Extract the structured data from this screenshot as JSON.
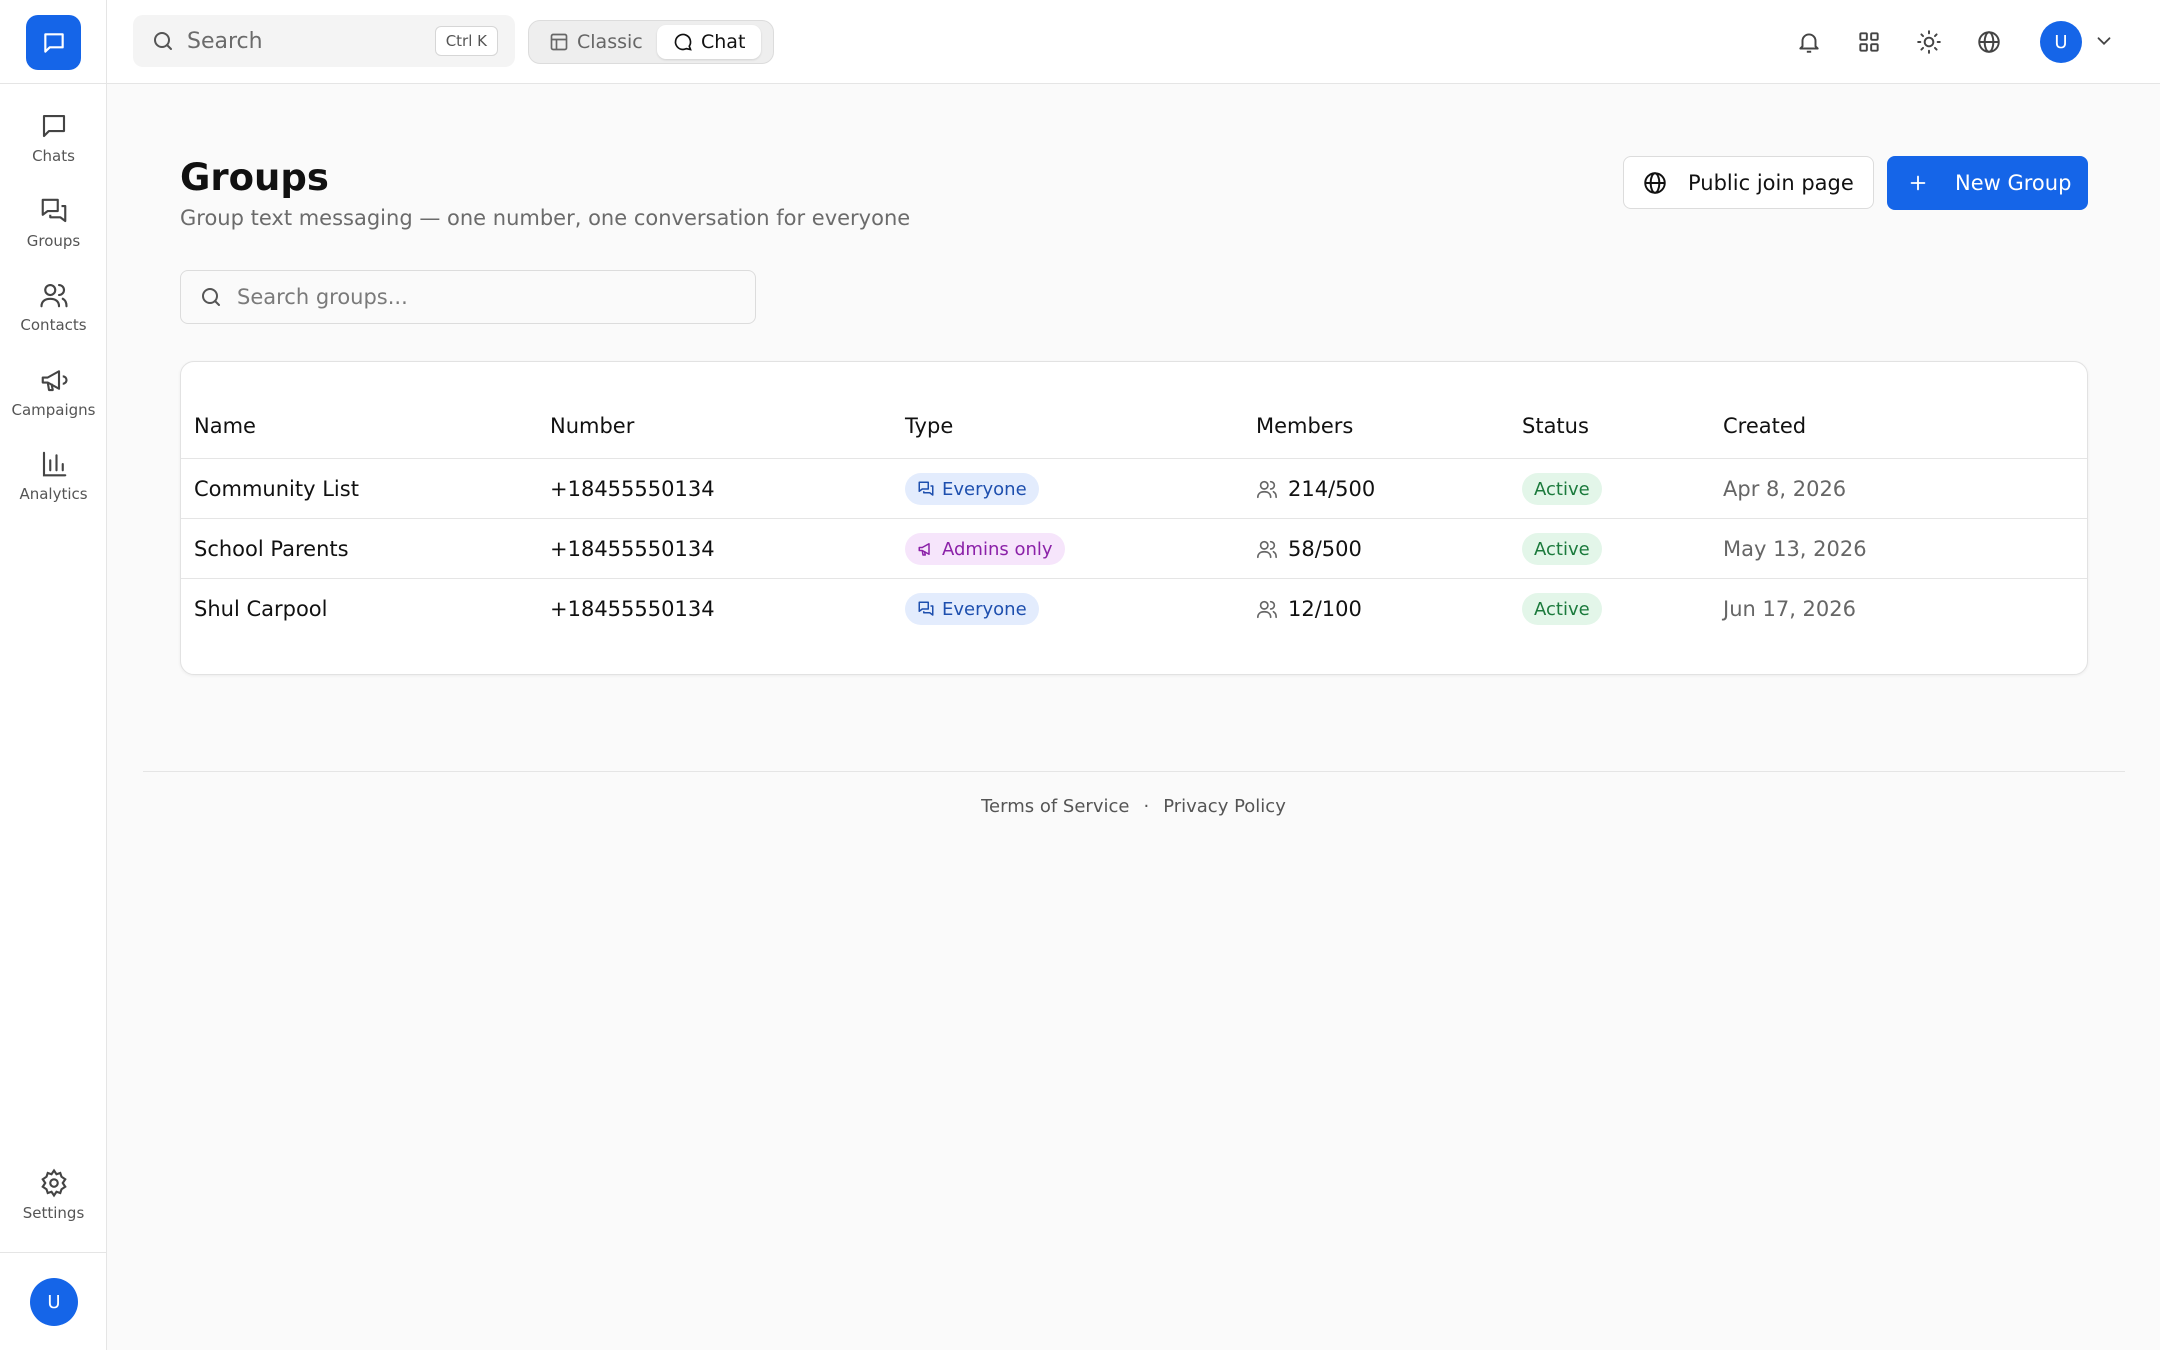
{
  "sidebar": {
    "items": [
      {
        "label": "Chats"
      },
      {
        "label": "Groups"
      },
      {
        "label": "Contacts"
      },
      {
        "label": "Campaigns"
      },
      {
        "label": "Analytics"
      }
    ],
    "settings_label": "Settings",
    "avatar_initial": "U"
  },
  "topbar": {
    "search_label": "Search",
    "search_shortcut": "Ctrl K",
    "view_toggle": {
      "classic": "Classic",
      "chat": "Chat",
      "active": "Chat"
    },
    "avatar_initial": "U"
  },
  "page": {
    "title": "Groups",
    "subtitle": "Group text messaging — one number, one conversation for everyone",
    "public_join_label": "Public join page",
    "new_group_label": "New Group",
    "search_placeholder": "Search groups..."
  },
  "table": {
    "columns": [
      "Name",
      "Number",
      "Type",
      "Members",
      "Status",
      "Created"
    ],
    "rows": [
      {
        "name": "Community List",
        "number": "+18455550134",
        "type": "Everyone",
        "members": "214/500",
        "status": "Active",
        "created": "Apr 8, 2026"
      },
      {
        "name": "School Parents",
        "number": "+18455550134",
        "type": "Admins only",
        "members": "58/500",
        "status": "Active",
        "created": "May 13, 2026"
      },
      {
        "name": "Shul Carpool",
        "number": "+18455550134",
        "type": "Everyone",
        "members": "12/100",
        "status": "Active",
        "created": "Jun 17, 2026"
      }
    ]
  },
  "footer": {
    "terms": "Terms of Service",
    "separator": "·",
    "privacy": "Privacy Policy"
  },
  "colors": {
    "accent": "#1565e8",
    "badge_everyone_bg": "#e3ecfd",
    "badge_admins_bg": "#f6e5fb",
    "badge_active_bg": "#e3f6e9"
  }
}
